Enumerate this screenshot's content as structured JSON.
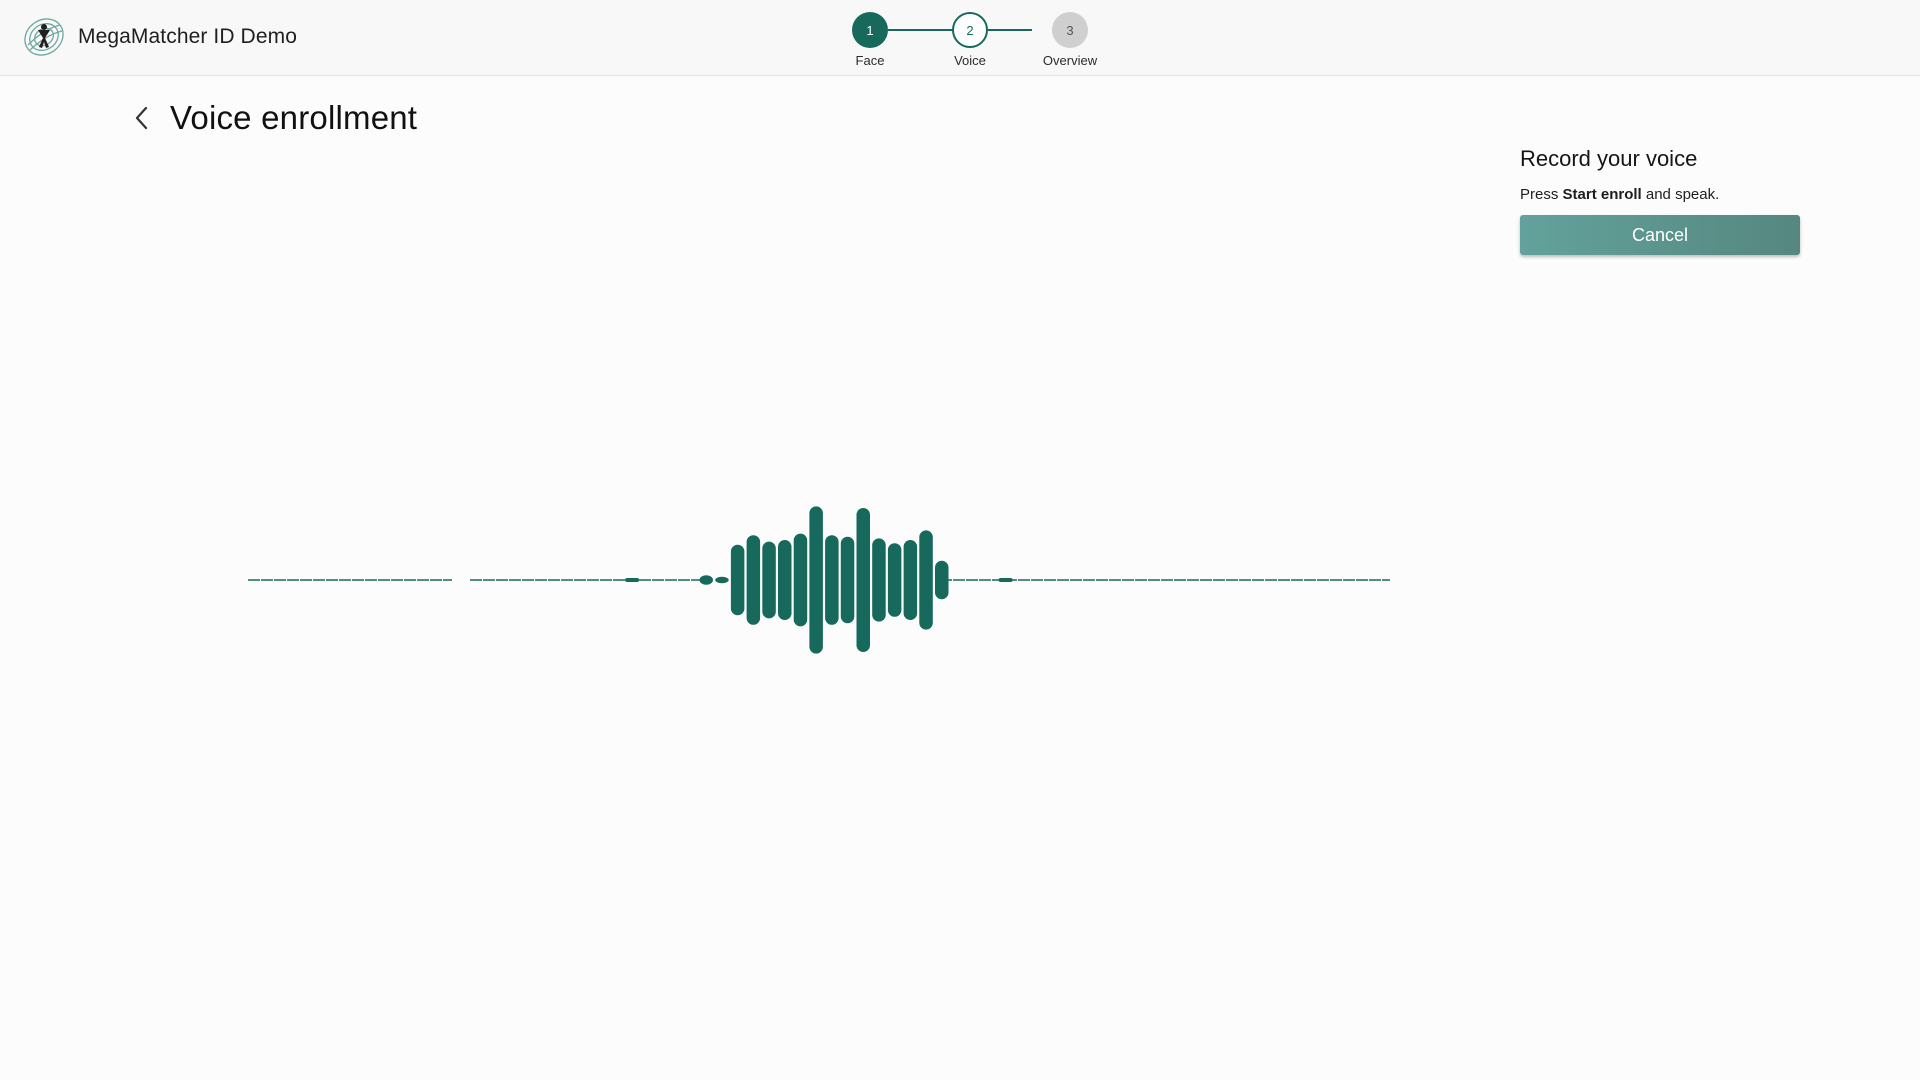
{
  "app": {
    "title": "MegaMatcher ID Demo"
  },
  "stepper": {
    "steps": [
      {
        "number": "1",
        "label": "Face",
        "state": "done"
      },
      {
        "number": "2",
        "label": "Voice",
        "state": "current"
      },
      {
        "number": "3",
        "label": "Overview",
        "state": "pending"
      }
    ]
  },
  "page": {
    "title": "Voice enrollment"
  },
  "panel": {
    "heading": "Record your voice",
    "instruction_prefix": "Press ",
    "instruction_emphasis": "Start enroll",
    "instruction_suffix": " and speak.",
    "cancel_label": "Cancel"
  },
  "waveform": {
    "bars": [
      0.06,
      0.04,
      0.44,
      0.56,
      0.48,
      0.5,
      0.58,
      0.92,
      0.56,
      0.54,
      0.9,
      0.52,
      0.46,
      0.5,
      0.62,
      0.24
    ],
    "markers": [
      0.338,
      0.66
    ]
  },
  "colors": {
    "accent": "#17695c",
    "button": "#5e9893",
    "pending": "#cfcfcf"
  },
  "icons": {
    "logo": "fingerprint-person-logo",
    "back": "chevron-left-icon"
  }
}
